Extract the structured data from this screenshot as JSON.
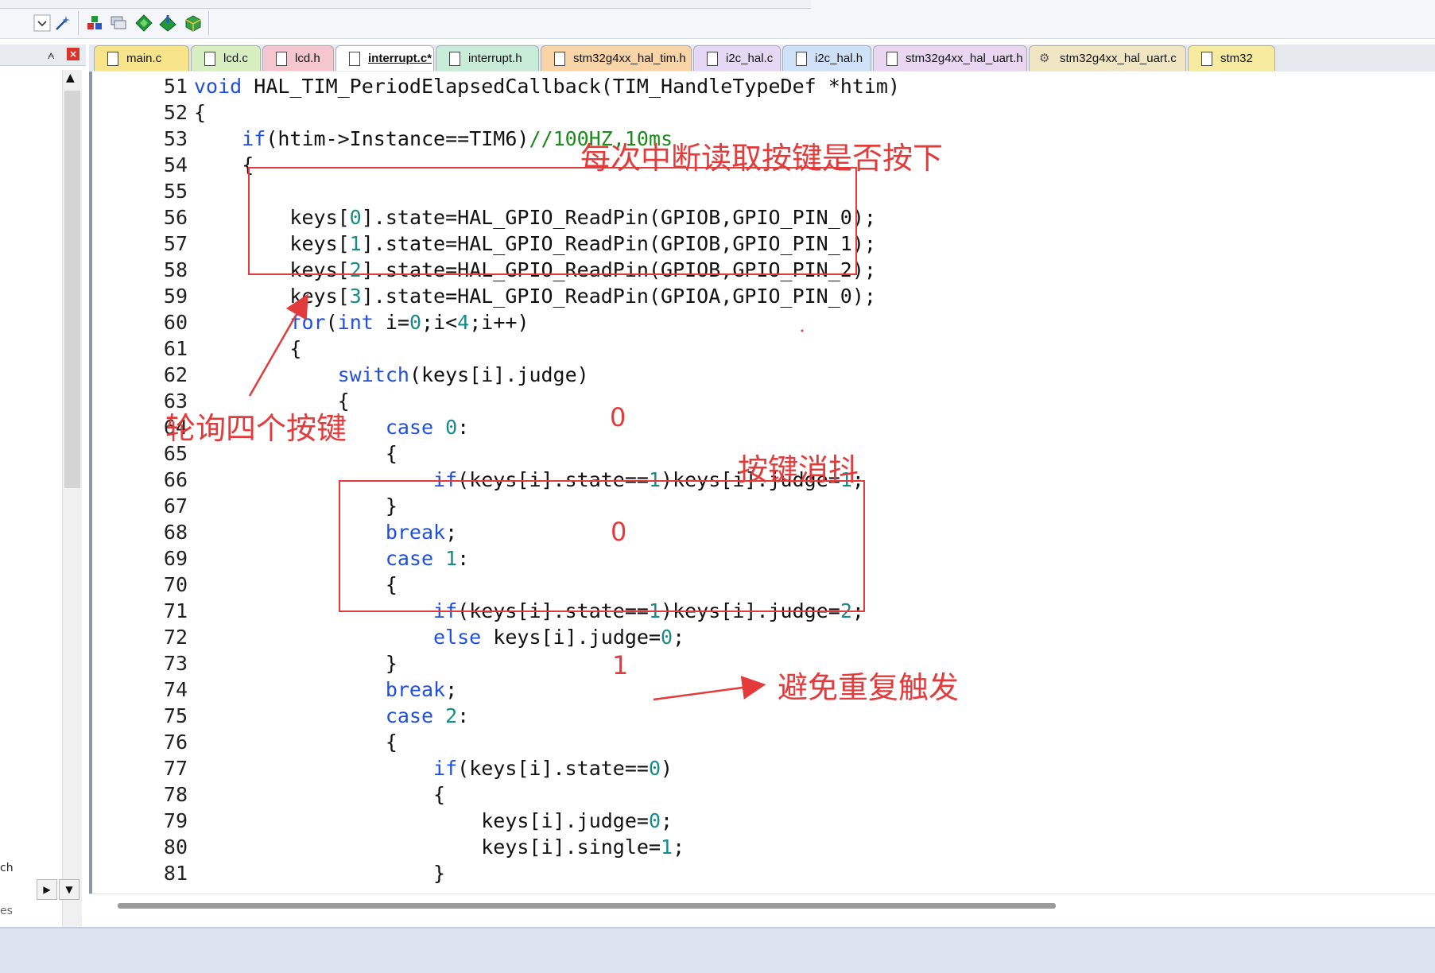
{
  "toolbar": {
    "icons": [
      "dropdown-chevron-icon",
      "wand-icon",
      "build-target-icon",
      "batch-build-icon",
      "diamond-green-icon",
      "diamond-load-icon",
      "package-installer-icon"
    ]
  },
  "left_panel": {
    "pin_glyph": "⩜",
    "close_glyph": "×",
    "partial_text_1": "ch",
    "partial_text_2": "es"
  },
  "tabs": [
    {
      "label": "main.c",
      "color": "#f8e48a",
      "active": false
    },
    {
      "label": "lcd.c",
      "color": "#d7efc0",
      "active": false
    },
    {
      "label": "lcd.h",
      "color": "#f6c6cf",
      "active": false
    },
    {
      "label": "interrupt.c*",
      "color": "#ffffff",
      "active": true
    },
    {
      "label": "interrupt.h",
      "color": "#c9ecd9",
      "active": false
    },
    {
      "label": "stm32g4xx_hal_tim.h",
      "color": "#f8d4a6",
      "active": false
    },
    {
      "label": "i2c_hal.c",
      "color": "#e4d8f4",
      "active": false
    },
    {
      "label": "i2c_hal.h",
      "color": "#cfe1f6",
      "active": false
    },
    {
      "label": "stm32g4xx_hal_uart.h",
      "color": "#e9d6f0",
      "active": false
    },
    {
      "label": "stm32g4xx_hal_uart.c",
      "color": "#f1e6c4",
      "active": false
    },
    {
      "label": "stm32",
      "color": "#f7eba0",
      "active": false
    }
  ],
  "code": {
    "lines": [
      {
        "n": "51",
        "t": [
          {
            "s": "void",
            "c": "kw"
          },
          {
            "s": " HAL_TIM_PeriodElapsedCallback(TIM_HandleTypeDef *htim)",
            "c": ""
          }
        ]
      },
      {
        "n": "52",
        "t": [
          {
            "s": "{",
            "c": ""
          }
        ]
      },
      {
        "n": "53",
        "t": [
          {
            "s": "    ",
            "c": ""
          },
          {
            "s": "if",
            "c": "kw"
          },
          {
            "s": "(htim->Instance==TIM6)",
            "c": ""
          },
          {
            "s": "//100HZ,10ms",
            "c": "cm"
          }
        ]
      },
      {
        "n": "54",
        "t": [
          {
            "s": "    {",
            "c": ""
          }
        ]
      },
      {
        "n": "55",
        "t": [
          {
            "s": "",
            "c": ""
          }
        ]
      },
      {
        "n": "56",
        "t": [
          {
            "s": "        keys[",
            "c": ""
          },
          {
            "s": "0",
            "c": "num"
          },
          {
            "s": "].state=HAL_GPIO_ReadPin(GPIOB,GPIO_PIN_0);",
            "c": ""
          }
        ]
      },
      {
        "n": "57",
        "t": [
          {
            "s": "        keys[",
            "c": ""
          },
          {
            "s": "1",
            "c": "num"
          },
          {
            "s": "].state=HAL_GPIO_ReadPin(GPIOB,GPIO_PIN_1);",
            "c": ""
          }
        ]
      },
      {
        "n": "58",
        "t": [
          {
            "s": "        keys[",
            "c": ""
          },
          {
            "s": "2",
            "c": "num"
          },
          {
            "s": "].state=HAL_GPIO_ReadPin(GPIOB,GPIO_PIN_2);",
            "c": ""
          }
        ]
      },
      {
        "n": "59",
        "t": [
          {
            "s": "        keys[",
            "c": ""
          },
          {
            "s": "3",
            "c": "num"
          },
          {
            "s": "].state=HAL_GPIO_ReadPin(GPIOA,GPIO_PIN_0);",
            "c": ""
          }
        ]
      },
      {
        "n": "60",
        "t": [
          {
            "s": "        ",
            "c": ""
          },
          {
            "s": "for",
            "c": "kw"
          },
          {
            "s": "(",
            "c": ""
          },
          {
            "s": "int",
            "c": "kw"
          },
          {
            "s": " i=",
            "c": ""
          },
          {
            "s": "0",
            "c": "num"
          },
          {
            "s": ";i<",
            "c": ""
          },
          {
            "s": "4",
            "c": "num"
          },
          {
            "s": ";i++)",
            "c": ""
          }
        ]
      },
      {
        "n": "61",
        "t": [
          {
            "s": "        {",
            "c": ""
          }
        ]
      },
      {
        "n": "62",
        "t": [
          {
            "s": "            ",
            "c": ""
          },
          {
            "s": "switch",
            "c": "kw"
          },
          {
            "s": "(keys[i].judge)",
            "c": ""
          }
        ]
      },
      {
        "n": "63",
        "t": [
          {
            "s": "            {",
            "c": ""
          }
        ]
      },
      {
        "n": "64",
        "t": [
          {
            "s": "                ",
            "c": ""
          },
          {
            "s": "case",
            "c": "kw"
          },
          {
            "s": " ",
            "c": ""
          },
          {
            "s": "0",
            "c": "num"
          },
          {
            "s": ":",
            "c": ""
          }
        ]
      },
      {
        "n": "65",
        "t": [
          {
            "s": "                {",
            "c": ""
          }
        ]
      },
      {
        "n": "66",
        "t": [
          {
            "s": "                    ",
            "c": ""
          },
          {
            "s": "if",
            "c": "kw"
          },
          {
            "s": "(keys[i].state==",
            "c": ""
          },
          {
            "s": "1",
            "c": "num"
          },
          {
            "s": ")keys[i].judge=",
            "c": ""
          },
          {
            "s": "1",
            "c": "num"
          },
          {
            "s": ";",
            "c": ""
          }
        ]
      },
      {
        "n": "67",
        "t": [
          {
            "s": "                }",
            "c": ""
          }
        ]
      },
      {
        "n": "68",
        "t": [
          {
            "s": "                ",
            "c": ""
          },
          {
            "s": "break",
            "c": "kw"
          },
          {
            "s": ";",
            "c": ""
          }
        ]
      },
      {
        "n": "69",
        "t": [
          {
            "s": "                ",
            "c": ""
          },
          {
            "s": "case",
            "c": "kw"
          },
          {
            "s": " ",
            "c": ""
          },
          {
            "s": "1",
            "c": "num"
          },
          {
            "s": ":",
            "c": ""
          }
        ]
      },
      {
        "n": "70",
        "t": [
          {
            "s": "                {",
            "c": ""
          }
        ]
      },
      {
        "n": "71",
        "t": [
          {
            "s": "                    ",
            "c": ""
          },
          {
            "s": "if",
            "c": "kw"
          },
          {
            "s": "(keys[i].state==",
            "c": ""
          },
          {
            "s": "1",
            "c": "num"
          },
          {
            "s": ")keys[i].judge=",
            "c": ""
          },
          {
            "s": "2",
            "c": "num"
          },
          {
            "s": ";",
            "c": ""
          }
        ]
      },
      {
        "n": "72",
        "t": [
          {
            "s": "                    ",
            "c": ""
          },
          {
            "s": "else",
            "c": "kw"
          },
          {
            "s": " keys[i].judge=",
            "c": ""
          },
          {
            "s": "0",
            "c": "num"
          },
          {
            "s": ";",
            "c": ""
          }
        ]
      },
      {
        "n": "73",
        "t": [
          {
            "s": "                }",
            "c": ""
          }
        ]
      },
      {
        "n": "74",
        "t": [
          {
            "s": "                ",
            "c": ""
          },
          {
            "s": "break",
            "c": "kw"
          },
          {
            "s": ";",
            "c": ""
          }
        ]
      },
      {
        "n": "75",
        "t": [
          {
            "s": "                ",
            "c": ""
          },
          {
            "s": "case",
            "c": "kw"
          },
          {
            "s": " ",
            "c": ""
          },
          {
            "s": "2",
            "c": "num"
          },
          {
            "s": ":",
            "c": ""
          }
        ]
      },
      {
        "n": "76",
        "t": [
          {
            "s": "                {",
            "c": ""
          }
        ]
      },
      {
        "n": "77",
        "t": [
          {
            "s": "                    ",
            "c": ""
          },
          {
            "s": "if",
            "c": "kw"
          },
          {
            "s": "(keys[i].state==",
            "c": ""
          },
          {
            "s": "0",
            "c": "num"
          },
          {
            "s": ")",
            "c": ""
          }
        ]
      },
      {
        "n": "78",
        "t": [
          {
            "s": "                    {",
            "c": ""
          }
        ]
      },
      {
        "n": "79",
        "t": [
          {
            "s": "                        keys[i].judge=",
            "c": ""
          },
          {
            "s": "0",
            "c": "num"
          },
          {
            "s": ";",
            "c": ""
          }
        ]
      },
      {
        "n": "80",
        "t": [
          {
            "s": "                        keys[i].single=",
            "c": ""
          },
          {
            "s": "1",
            "c": "num"
          },
          {
            "s": ";",
            "c": ""
          }
        ]
      },
      {
        "n": "81",
        "t": [
          {
            "s": "                    }",
            "c": ""
          }
        ]
      }
    ]
  },
  "annotations": {
    "read_keys_each_interrupt": "每次中断读取按键是否按下",
    "poll_four_keys": "轮询四个按键",
    "debounce": "按键消抖",
    "avoid_repeat_trigger": "避免重复触发",
    "correction_line66": "0",
    "correction_line71": "0",
    "correction_line77": "1",
    "color": "#e33b3b"
  },
  "colors": {
    "keyword": "#1f4fe0",
    "number": "#178a8a",
    "comment": "#1a8a1a",
    "annotation": "#e33b3b"
  }
}
